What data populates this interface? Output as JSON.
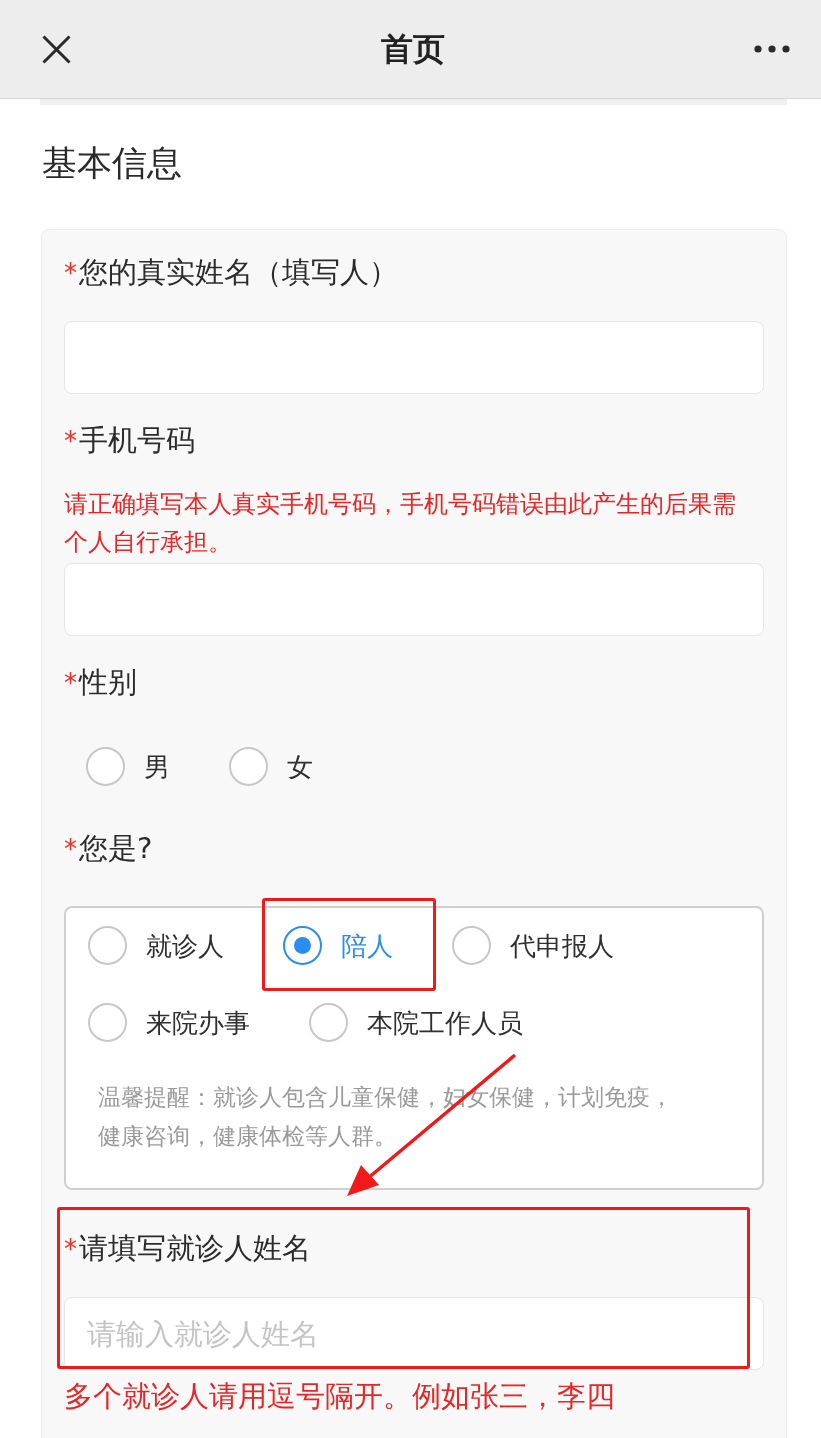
{
  "nav": {
    "title": "首页"
  },
  "section_title": "基本信息",
  "fields": [
    {
      "kind": "text",
      "required_mark": "*",
      "label": "您的真实姓名（填写人）",
      "highlighted": false
    },
    {
      "kind": "text",
      "required_mark": "*",
      "label": "手机号码",
      "note": "请正确填写本人真实手机号码，手机号码错误由此产生的后果需个人自行承担。",
      "highlighted": false
    },
    {
      "kind": "radio",
      "required_mark": "*",
      "label": "性别",
      "boxed": false,
      "options": [
        {
          "label": "男",
          "selected": false,
          "highlighted": false
        },
        {
          "label": "女",
          "selected": false,
          "highlighted": false
        }
      ]
    },
    {
      "kind": "radio",
      "required_mark": "*",
      "label": "您是?",
      "boxed": true,
      "options": [
        {
          "label": "就诊人",
          "selected": false,
          "highlighted": false
        },
        {
          "label": "陪人",
          "selected": true,
          "highlighted": true
        },
        {
          "label": "代申报人",
          "selected": false,
          "highlighted": false
        },
        {
          "label": "来院办事",
          "selected": false,
          "highlighted": false
        },
        {
          "label": "本院工作人员",
          "selected": false,
          "highlighted": false
        }
      ],
      "tip": "温馨提醒：就诊人包含儿童保健，妇女保健，计划免疫，健康咨询，健康体检等人群。",
      "tip_arrow": true
    },
    {
      "kind": "text",
      "required_mark": "*",
      "label": "请填写就诊人姓名",
      "placeholder": "请输入就诊人姓名",
      "highlighted": true,
      "hint": "多个就诊人请用逗号隔开。例如张三，李四"
    }
  ]
}
